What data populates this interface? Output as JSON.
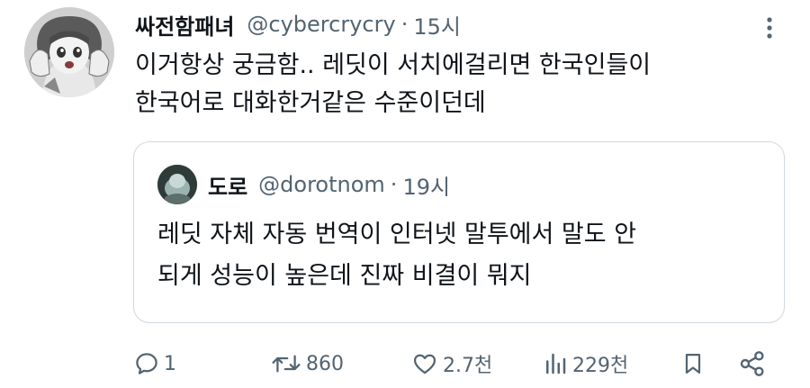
{
  "tweet": {
    "author_name": "싸전함패녀",
    "handle": "@cybercrycry",
    "separator": "·",
    "time": "15시",
    "text_line1": "이거항상 궁금함.. 레딧이 서치에걸리면 한국인들이",
    "text_line2": "한국어로 대화한거같은 수준이던데",
    "more_icon": "more-dots-icon"
  },
  "quote": {
    "author_name": "도로",
    "handle": "@dorotnom",
    "separator": "·",
    "time": "19시",
    "text_line1": "레딧 자체 자동 번역이 인터넷 말투에서 말도 안",
    "text_line2": "되게 성능이 높은데 진짜 비결이 뭐지"
  },
  "actions": {
    "reply_count": "1",
    "retweet_count": "860",
    "like_count": "2.7천",
    "views_count": "229천"
  },
  "colors": {
    "text": "#0f1419",
    "secondary": "#536471",
    "border": "#cfd9de",
    "background": "#ffffff"
  }
}
